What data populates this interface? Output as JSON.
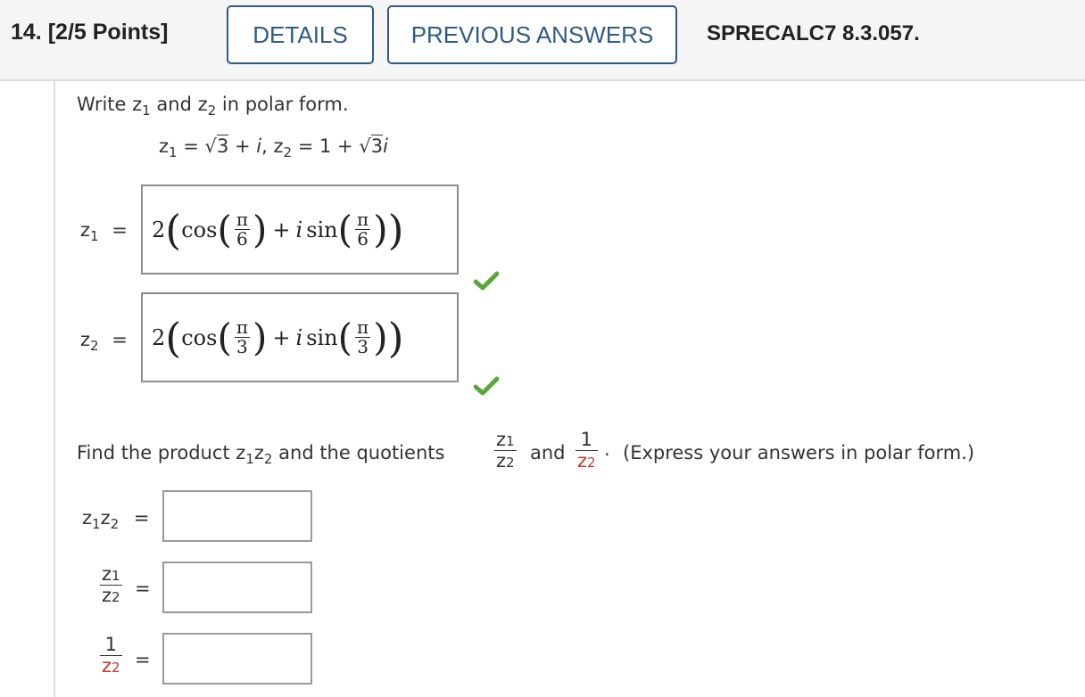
{
  "header": {
    "question_number": "14.",
    "points": "[2/5 Points]",
    "details_label": "DETAILS",
    "previous_answers_label": "PREVIOUS ANSWERS",
    "problem_code": "SPRECALC7 8.3.057."
  },
  "question": {
    "prompt_write": "Write",
    "prompt_and": "and",
    "prompt_tail": "in polar form.",
    "var_z": "z",
    "sub1": "1",
    "sub2": "2",
    "given": {
      "z1_rhs_a": "= ",
      "sqrt3": "3",
      "z1_rhs_b": " + ",
      "i": "i",
      "comma": ",  ",
      "z2_eq": " = 1 + ",
      "sqrt3b": "3",
      "i2": "i"
    }
  },
  "answers_part1": [
    {
      "label_var": "z",
      "label_sub": "1",
      "eq": "=",
      "coef": "2",
      "cos": "cos",
      "plus": "+",
      "i": "i",
      "sin": "sin",
      "pi": "π",
      "den": "6",
      "status": "correct"
    },
    {
      "label_var": "z",
      "label_sub": "2",
      "eq": "=",
      "coef": "2",
      "cos": "cos",
      "plus": "+",
      "i": "i",
      "sin": "sin",
      "pi": "π",
      "den": "3",
      "status": "correct"
    }
  ],
  "part2": {
    "prompt_find": "Find the product",
    "prompt_quotients": "and the quotients",
    "prompt_and": "and",
    "one": "1",
    "period": ".",
    "prompt_tail": "(Express your answers in polar form.)",
    "eq": "=",
    "inputs": [
      {
        "label": "z1z2",
        "value": ""
      },
      {
        "label": "z1/z2",
        "value": ""
      },
      {
        "label": "1/z2",
        "value": ""
      }
    ]
  },
  "colors": {
    "button_border": "#2e5c86",
    "check_green": "#5aa63a",
    "red_variable": "#c0392b"
  },
  "icons": {
    "correct": "check-icon"
  }
}
